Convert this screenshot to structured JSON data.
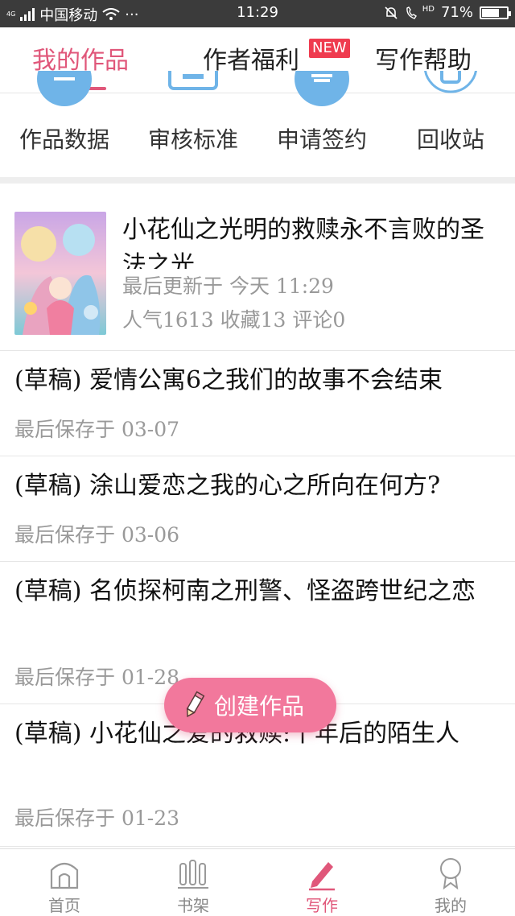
{
  "status_bar": {
    "signal_tag": "4G",
    "carrier": "中国移动",
    "dots": "···",
    "time": "11:29",
    "network_tag": "HD",
    "battery": "71%",
    "battery_level": 0.71
  },
  "top_tabs": [
    {
      "label": "我的作品",
      "active": true
    },
    {
      "label": "作者福利",
      "badge": "NEW"
    },
    {
      "label": "写作帮助"
    }
  ],
  "quick_menu": [
    {
      "label": "作品数据",
      "icon": "chart-icon"
    },
    {
      "label": "审核标准",
      "icon": "card-icon"
    },
    {
      "label": "申请签约",
      "icon": "contract-icon"
    },
    {
      "label": "回收站",
      "icon": "recycle-icon"
    }
  ],
  "works": [
    {
      "title": "小花仙之光明的救赎永不言败的圣法之光",
      "updated": "最后更新于 今天 11:29",
      "stats": "人气1613 收藏13 评论0"
    }
  ],
  "drafts": [
    {
      "title": "(草稿) 爱情公寓6之我们的故事不会结束",
      "saved": "最后保存于 03-07"
    },
    {
      "title": "(草稿) 涂山爱恋之我的心之所向在何方?",
      "saved": "最后保存于 03-06"
    },
    {
      "title": "(草稿) 名侦探柯南之刑警、怪盗跨世纪之恋",
      "saved": "最后保存于 01-28"
    },
    {
      "title": "(草稿) 小花仙之爱的救赎:十年后的陌生人",
      "saved": "最后保存于 01-23"
    }
  ],
  "create_button": {
    "label": "创建作品"
  },
  "bottom_nav": [
    {
      "label": "首页",
      "icon": "home-icon"
    },
    {
      "label": "书架",
      "icon": "bookshelf-icon"
    },
    {
      "label": "写作",
      "icon": "pen-icon",
      "active": true
    },
    {
      "label": "我的",
      "icon": "profile-icon"
    }
  ],
  "colors": {
    "accent": "#e0577a",
    "button": "#f2789c",
    "badge": "#ef3b4f",
    "icon_blue": "#6fb4e8"
  }
}
